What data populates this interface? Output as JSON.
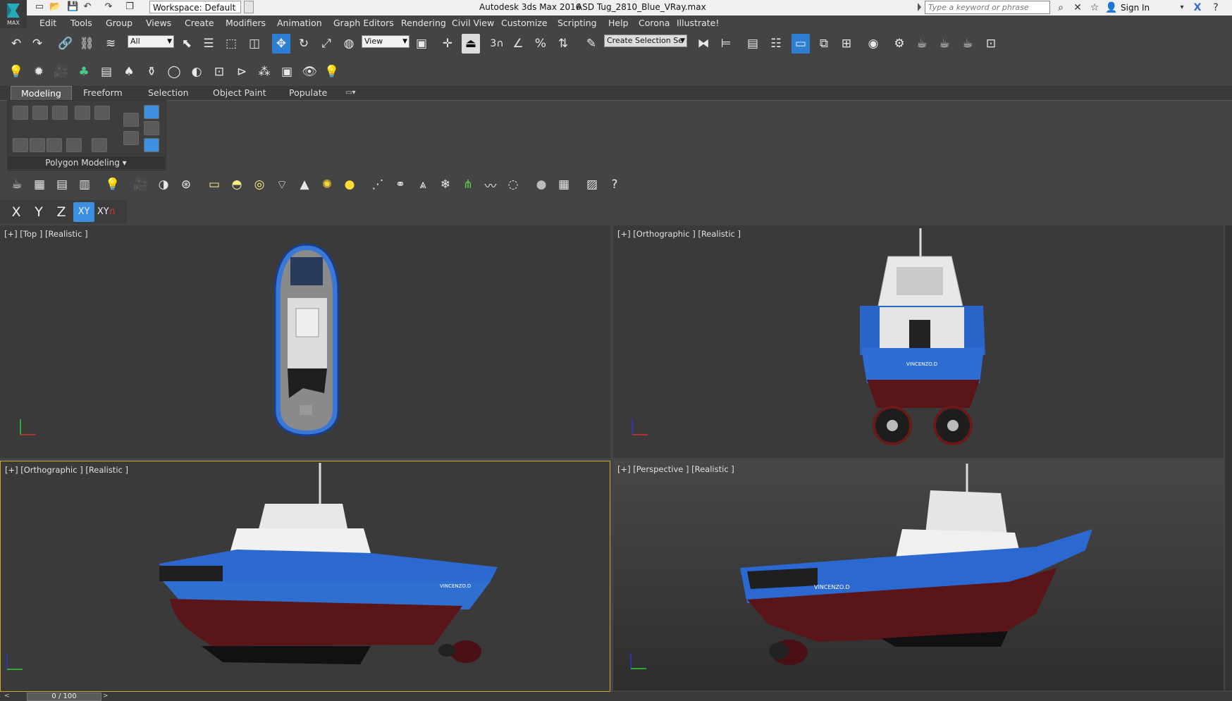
{
  "app": {
    "title": "Autodesk 3ds Max 2016",
    "file": "ASD Tug_2810_Blue_VRay.max",
    "logo_text": "MAX",
    "workspace": "Workspace: Default",
    "search_placeholder": "Type a keyword or phrase",
    "sign_in": "Sign In"
  },
  "menu": [
    "Edit",
    "Tools",
    "Group",
    "Views",
    "Create",
    "Modifiers",
    "Animation",
    "Graph Editors",
    "Rendering",
    "Civil View",
    "Customize",
    "Scripting",
    "Help",
    "Corona",
    "Illustrate!"
  ],
  "toolbar": {
    "selection_filter": "All",
    "ref_coord": "View",
    "named_selection": "Create Selection Se",
    "snap_value": "3"
  },
  "ribbon": {
    "tabs": [
      "Modeling",
      "Freeform",
      "Selection",
      "Object Paint",
      "Populate"
    ],
    "active_tab": "Modeling",
    "panel_label": "Polygon Modeling"
  },
  "axis_constraints": [
    "X",
    "Y",
    "Z",
    "XY",
    "XY"
  ],
  "viewports": [
    {
      "label": "[+] [Top ] [Realistic ]",
      "active": false
    },
    {
      "label": "[+] [Orthographic ] [Realistic ]",
      "active": false
    },
    {
      "label": "[+] [Orthographic ] [Realistic ]",
      "active": true
    },
    {
      "label": "[+] [Perspective ] [Realistic ]",
      "active": false
    }
  ],
  "model_name_text": "VINCENZO.D",
  "timeline": {
    "frame": "0 / 100"
  },
  "colors": {
    "hull_blue": "#2f6fd0",
    "hull_red": "#5a1518",
    "active_button": "#2e7fd4",
    "viewport_bg": "#3a3a3a"
  }
}
